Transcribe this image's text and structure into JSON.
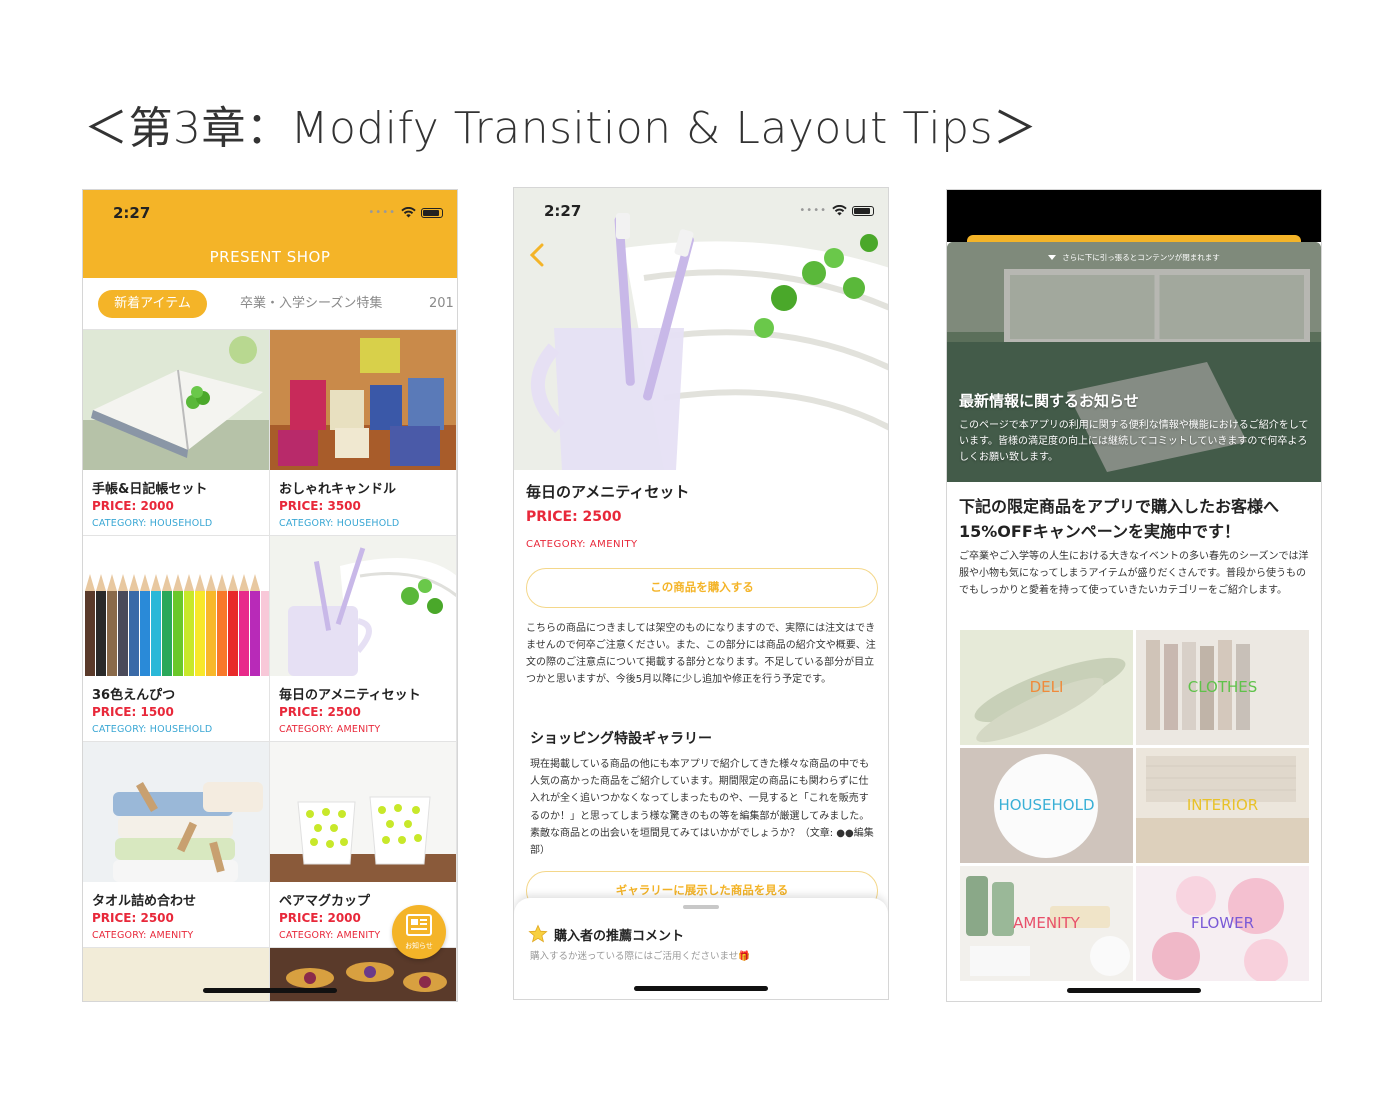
{
  "page_title": "＜第3章：Modify Transition & Layout Tips＞",
  "colors": {
    "accent": "#f4b428",
    "price_red": "#e8283a",
    "household_blue": "#3aa7d4"
  },
  "status_bar": {
    "time": "2:27"
  },
  "phone1": {
    "title": "PRESENT SHOP",
    "tabs": [
      "新着アイテム",
      "卒業・入学シーズン特集",
      "201"
    ],
    "items": [
      {
        "name": "手帳&日記帳セット",
        "price": "PRICE: 2000",
        "category": "CATEGORY: HOUSEHOLD",
        "image": "notebook-clover"
      },
      {
        "name": "おしゃれキャンドル",
        "price": "PRICE: 3500",
        "category": "CATEGORY: HOUSEHOLD",
        "image": "candles"
      },
      {
        "name": "36色えんぴつ",
        "price": "PRICE: 1500",
        "category": "CATEGORY: HOUSEHOLD",
        "image": "color-pencils"
      },
      {
        "name": "毎日のアメニティセット",
        "price": "PRICE: 2500",
        "category": "CATEGORY: AMENITY",
        "image": "toothbrush-towel"
      },
      {
        "name": "タオル詰め合わせ",
        "price": "PRICE: 2500",
        "category": "CATEGORY: AMENITY",
        "image": "towels-clothespins"
      },
      {
        "name": "ペアマグカップ",
        "price": "PRICE: 2000",
        "category": "CATEGORY: AMENITY",
        "image": "polka-dot-mugs"
      }
    ],
    "news_button_label": "お知らせ",
    "news_icon": "newspaper-icon"
  },
  "phone2": {
    "name": "毎日のアメニティセット",
    "price": "PRICE: 2500",
    "category": "CATEGORY: AMENITY",
    "buy_label": "この商品を購入する",
    "description": "こちらの商品につきましては架空のものになりますので、実際には注文はできませんので何卒ご注意ください。また、この部分には商品の紹介文や概要、注文の際のご注意点について掲載する部分となります。不足している部分が目立つかと思いますが、今後5月以降に少し追加や修正を行う予定です。",
    "gallery_title": "ショッピング特設ギャラリー",
    "gallery_text": "現在掲載している商品の他にも本アプリで紹介してきた様々な商品の中でも人気の高かった商品をご紹介しています。期間限定の商品にも関わらずに仕入れが全く追いつかなくなってしまったものや、一見すると「これを販売するのか！」と思ってしまう様な驚きのもの等を編集部が厳選してみました。素敵な商品との出会いを垣間見てみてはいかがでしょうか？（文章: ●●編集部）",
    "gallery_button": "ギャラリーに展示した商品を見る",
    "sheet_title": "購入者の推薦コメント",
    "sheet_sub": "購入するか迷っている際にはご活用くださいませ🎁",
    "star_icon": "star-icon"
  },
  "phone3": {
    "pull_hint": "さらに下に引っ張るとコンテンツが閉まれます",
    "banner_title": "最新情報に関するお知らせ",
    "banner_text": "このページで本アプリの利用に関する便利な情報や機能におけるご紹介をしています。皆様の満足度の向上には継続してコミットしていきますので何卒よろしくお願い致します。",
    "heading": "下記の限定商品をアプリで購入したお客様へ15%OFFキャンペーンを実施中です！",
    "text": "ご卒業やご入学等の人生における大きなイベントの多い春先のシーズンでは洋服や小物も気になってしまうアイテムが盛りだくさんです。普段から使うものでもしっかりと愛着を持って使っていきたいカテゴリーをご紹介します。",
    "categories": [
      {
        "label": "DELI",
        "color": "#f08a3a"
      },
      {
        "label": "CLOTHES",
        "color": "#5fc24a"
      },
      {
        "label": "HOUSEHOLD",
        "color": "#3ab0d6"
      },
      {
        "label": "INTERIOR",
        "color": "#e8c22a"
      },
      {
        "label": "AMENITY",
        "color": "#e8506a"
      },
      {
        "label": "FLOWER",
        "color": "#7a5ad6"
      }
    ]
  }
}
